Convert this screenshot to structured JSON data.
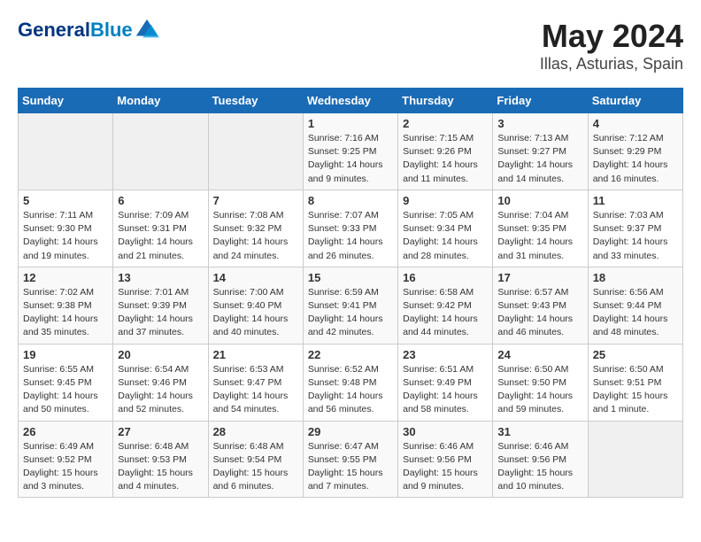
{
  "header": {
    "logo_line1": "General",
    "logo_line2": "Blue",
    "title": "May 2024",
    "subtitle": "Illas, Asturias, Spain"
  },
  "weekdays": [
    "Sunday",
    "Monday",
    "Tuesday",
    "Wednesday",
    "Thursday",
    "Friday",
    "Saturday"
  ],
  "weeks": [
    [
      {
        "day": "",
        "empty": true
      },
      {
        "day": "",
        "empty": true
      },
      {
        "day": "",
        "empty": true
      },
      {
        "day": "1",
        "sunrise": "7:16 AM",
        "sunset": "9:25 PM",
        "daylight": "14 hours and 9 minutes."
      },
      {
        "day": "2",
        "sunrise": "7:15 AM",
        "sunset": "9:26 PM",
        "daylight": "14 hours and 11 minutes."
      },
      {
        "day": "3",
        "sunrise": "7:13 AM",
        "sunset": "9:27 PM",
        "daylight": "14 hours and 14 minutes."
      },
      {
        "day": "4",
        "sunrise": "7:12 AM",
        "sunset": "9:29 PM",
        "daylight": "14 hours and 16 minutes."
      }
    ],
    [
      {
        "day": "5",
        "sunrise": "7:11 AM",
        "sunset": "9:30 PM",
        "daylight": "14 hours and 19 minutes."
      },
      {
        "day": "6",
        "sunrise": "7:09 AM",
        "sunset": "9:31 PM",
        "daylight": "14 hours and 21 minutes."
      },
      {
        "day": "7",
        "sunrise": "7:08 AM",
        "sunset": "9:32 PM",
        "daylight": "14 hours and 24 minutes."
      },
      {
        "day": "8",
        "sunrise": "7:07 AM",
        "sunset": "9:33 PM",
        "daylight": "14 hours and 26 minutes."
      },
      {
        "day": "9",
        "sunrise": "7:05 AM",
        "sunset": "9:34 PM",
        "daylight": "14 hours and 28 minutes."
      },
      {
        "day": "10",
        "sunrise": "7:04 AM",
        "sunset": "9:35 PM",
        "daylight": "14 hours and 31 minutes."
      },
      {
        "day": "11",
        "sunrise": "7:03 AM",
        "sunset": "9:37 PM",
        "daylight": "14 hours and 33 minutes."
      }
    ],
    [
      {
        "day": "12",
        "sunrise": "7:02 AM",
        "sunset": "9:38 PM",
        "daylight": "14 hours and 35 minutes."
      },
      {
        "day": "13",
        "sunrise": "7:01 AM",
        "sunset": "9:39 PM",
        "daylight": "14 hours and 37 minutes."
      },
      {
        "day": "14",
        "sunrise": "7:00 AM",
        "sunset": "9:40 PM",
        "daylight": "14 hours and 40 minutes."
      },
      {
        "day": "15",
        "sunrise": "6:59 AM",
        "sunset": "9:41 PM",
        "daylight": "14 hours and 42 minutes."
      },
      {
        "day": "16",
        "sunrise": "6:58 AM",
        "sunset": "9:42 PM",
        "daylight": "14 hours and 44 minutes."
      },
      {
        "day": "17",
        "sunrise": "6:57 AM",
        "sunset": "9:43 PM",
        "daylight": "14 hours and 46 minutes."
      },
      {
        "day": "18",
        "sunrise": "6:56 AM",
        "sunset": "9:44 PM",
        "daylight": "14 hours and 48 minutes."
      }
    ],
    [
      {
        "day": "19",
        "sunrise": "6:55 AM",
        "sunset": "9:45 PM",
        "daylight": "14 hours and 50 minutes."
      },
      {
        "day": "20",
        "sunrise": "6:54 AM",
        "sunset": "9:46 PM",
        "daylight": "14 hours and 52 minutes."
      },
      {
        "day": "21",
        "sunrise": "6:53 AM",
        "sunset": "9:47 PM",
        "daylight": "14 hours and 54 minutes."
      },
      {
        "day": "22",
        "sunrise": "6:52 AM",
        "sunset": "9:48 PM",
        "daylight": "14 hours and 56 minutes."
      },
      {
        "day": "23",
        "sunrise": "6:51 AM",
        "sunset": "9:49 PM",
        "daylight": "14 hours and 58 minutes."
      },
      {
        "day": "24",
        "sunrise": "6:50 AM",
        "sunset": "9:50 PM",
        "daylight": "14 hours and 59 minutes."
      },
      {
        "day": "25",
        "sunrise": "6:50 AM",
        "sunset": "9:51 PM",
        "daylight": "15 hours and 1 minute."
      }
    ],
    [
      {
        "day": "26",
        "sunrise": "6:49 AM",
        "sunset": "9:52 PM",
        "daylight": "15 hours and 3 minutes."
      },
      {
        "day": "27",
        "sunrise": "6:48 AM",
        "sunset": "9:53 PM",
        "daylight": "15 hours and 4 minutes."
      },
      {
        "day": "28",
        "sunrise": "6:48 AM",
        "sunset": "9:54 PM",
        "daylight": "15 hours and 6 minutes."
      },
      {
        "day": "29",
        "sunrise": "6:47 AM",
        "sunset": "9:55 PM",
        "daylight": "15 hours and 7 minutes."
      },
      {
        "day": "30",
        "sunrise": "6:46 AM",
        "sunset": "9:56 PM",
        "daylight": "15 hours and 9 minutes."
      },
      {
        "day": "31",
        "sunrise": "6:46 AM",
        "sunset": "9:56 PM",
        "daylight": "15 hours and 10 minutes."
      },
      {
        "day": "",
        "empty": true
      }
    ]
  ],
  "labels": {
    "sunrise": "Sunrise:",
    "sunset": "Sunset:",
    "daylight": "Daylight:"
  }
}
